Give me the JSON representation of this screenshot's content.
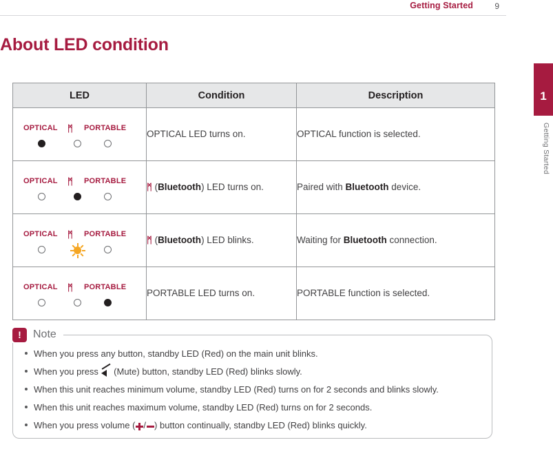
{
  "header": {
    "title": "Getting Started",
    "page_number": "9"
  },
  "side_tab": {
    "number": "1",
    "label": "Getting Started"
  },
  "doc": {
    "title": "About LED condition"
  },
  "table": {
    "headers": {
      "led": "LED",
      "condition": "Condition",
      "description": "Description"
    },
    "led_labels": {
      "optical": "OPTICAL",
      "bluetooth_icon": "bluetooth-icon",
      "portable": "PORTABLE"
    },
    "rows": [
      {
        "states": [
          "on",
          "off",
          "off"
        ],
        "blink_index": -1,
        "condition": "OPTICAL LED turns on.",
        "condition_html": "OPTICAL LED turns on.",
        "description": "OPTICAL function is selected.",
        "description_html": "OPTICAL function is selected."
      },
      {
        "states": [
          "off",
          "on",
          "off"
        ],
        "blink_index": -1,
        "condition": "(Bluetooth) LED turns on.",
        "condition_html": "bt (<b>Bluetooth</b>) LED turns on.",
        "description": "Paired with Bluetooth device.",
        "description_html": "Paired with <b>Bluetooth</b> device."
      },
      {
        "states": [
          "off",
          "blink",
          "off"
        ],
        "blink_index": 1,
        "condition": "(Bluetooth) LED blinks.",
        "condition_html": "bt (<b>Bluetooth</b>) LED blinks.",
        "description": "Waiting for Bluetooth connection.",
        "description_html": "Waiting for <b>Bluetooth</b> connection."
      },
      {
        "states": [
          "off",
          "off",
          "on"
        ],
        "blink_index": -1,
        "condition": "PORTABLE LED turns on.",
        "condition_html": "PORTABLE LED turns on.",
        "description": "PORTABLE function is selected.",
        "description_html": "PORTABLE function is selected."
      }
    ]
  },
  "note": {
    "icon": "exclamation-icon",
    "icon_glyph": "!",
    "title": "Note",
    "items": [
      {
        "text": "When you press any button, standby LED (Red) on the main unit blinks.",
        "html": "When you press any button, standby LED (Red) on the main unit blinks."
      },
      {
        "text": "When you press (Mute) button, standby LED (Red) blinks slowly.",
        "html": "When you press MUTEICON (Mute) button, standby LED (Red) blinks slowly."
      },
      {
        "text": "When this unit reaches minimum volume, standby LED (Red) turns on for 2 seconds and blinks slowly.",
        "html": "When this unit reaches minimum volume, standby LED (Red) turns on for 2 seconds and blinks slowly."
      },
      {
        "text": "When this unit reaches maximum volume, standby LED (Red) turns on for 2 seconds.",
        "html": "When this unit reaches maximum volume, standby LED (Red) turns on for 2 seconds."
      },
      {
        "text": "When you press volume (+/-) button continually, standby LED (Red) blinks quickly.",
        "html": "When you press volume (VOLPLUS/VOLMINUS) button continually, standby LED (Red) blinks quickly."
      }
    ]
  },
  "colors": {
    "accent": "#a61b40",
    "table_header_bg": "#e6e7e8",
    "border": "#939598",
    "blink": "#f5a623"
  }
}
